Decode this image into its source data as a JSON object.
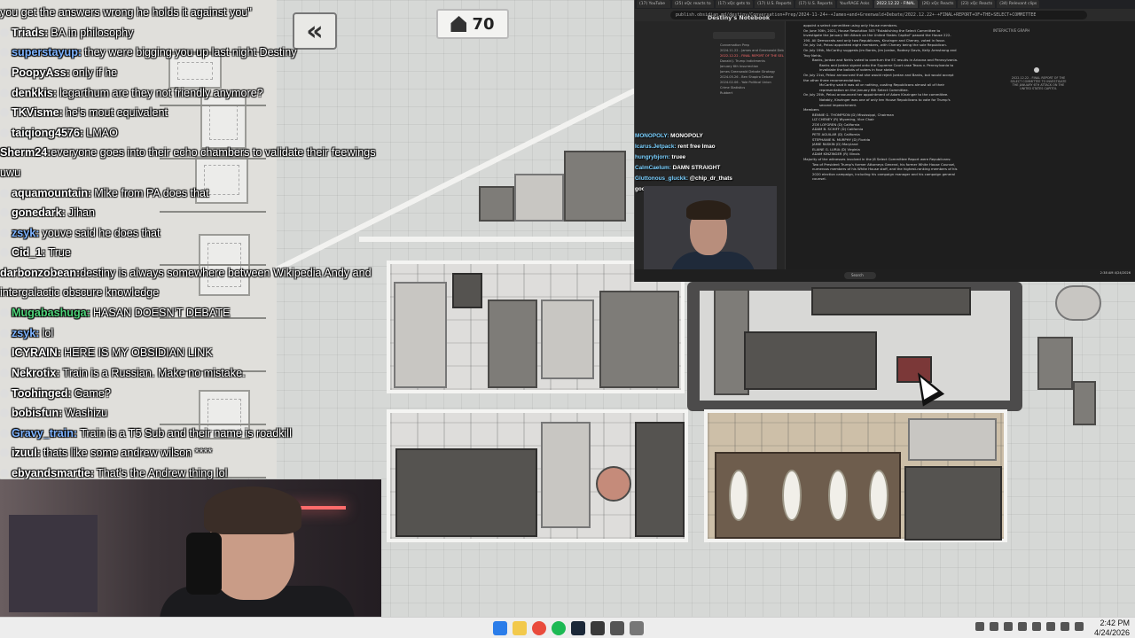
{
  "game": {
    "counter_value": "70",
    "back_label": "«"
  },
  "chat": {
    "messages": [
      {
        "user": "",
        "text": "you get the answers wrong he holds it against you\"",
        "color": "#ffffff"
      },
      {
        "user": "Triads",
        "text": "BA in philosophy",
        "color": "#ffffff"
      },
      {
        "user": "superstayup",
        "text": "they were bigging you up last night Destiny",
        "color": "#7fb4ff"
      },
      {
        "user": "PoopyAss",
        "text": "only if he",
        "color": "#ffffff"
      },
      {
        "user": "denkkis",
        "text": "legarthum are they not friendly anymore?",
        "color": "#ffffff"
      },
      {
        "user": "TKVisme",
        "text": "he's mout equivalent",
        "color": "#ffffff"
      },
      {
        "user": "taiqiong4576",
        "text": "LMAO",
        "color": "#ffffff"
      },
      {
        "user": "Sherm24",
        "text": "everyone goes into their echo chambers to validate their feewings uwu",
        "color": "#ffffff"
      },
      {
        "user": "aquamountain",
        "text": "Mike from PA does that",
        "color": "#ffffff"
      },
      {
        "user": "gonedark",
        "text": "Jihan",
        "color": "#ffffff"
      },
      {
        "user": "zsyk",
        "text": "youve said he does that",
        "color": "#7fb4ff"
      },
      {
        "user": "Cid_1",
        "text": "True",
        "color": "#ffffff"
      },
      {
        "user": "darbonzobean",
        "text": "destiny is always somewhere between Wikipedia Andy and intergalactic obscure knowledge",
        "color": "#ffffff"
      },
      {
        "user": "Mugabashuga",
        "text": "HASAN DOESN'T DEBATE",
        "color": "#4fd37a"
      },
      {
        "user": "zsyk",
        "text": "lol",
        "color": "#7fb4ff"
      },
      {
        "user": "ICYRAIN",
        "text": "HERE IS MY OBSIDIAN LINK",
        "color": "#ffffff"
      },
      {
        "user": "Nekrotix",
        "text": "Train is a Russian. Make no mistake.",
        "color": "#ffffff"
      },
      {
        "user": "Toohinged",
        "text": "Game?",
        "color": "#ffffff"
      },
      {
        "user": "bobisfun",
        "text": "Washizu",
        "color": "#ffffff"
      },
      {
        "user": "Gravy_train",
        "text": "Train is a T5 Sub and their name is roadkill",
        "color": "#7fb4ff"
      },
      {
        "user": "izuul",
        "text": "thats like some andrew wilson ****",
        "color": "#ffffff"
      },
      {
        "user": "ebyandsmartie",
        "text": "That's the Andrew thing lol",
        "color": "#ffffff"
      }
    ]
  },
  "browser": {
    "tabs": [
      "(17) YouTube",
      "(25) xQc reacts to",
      "(17) xQc gets to",
      "(17) U.S. Reports",
      "(17) U.S. Reports",
      "YourRAGE Asks",
      "2022.12.22 - FINAL",
      "(26) xQc Reacts",
      "(23) xQc Reacts",
      "(34) Relevant clips"
    ],
    "url": "publish.obsidian.md/destiny/Conversation+Prep/2024-11-24+-+James+and+Greenwald+Debate/2022.12.22+-+FINAL+REPORT+OF+THE+SELECT+COMMITTEE",
    "notebook_title": "Destiny's Notebook",
    "nav_items": [
      "Conversation Prep",
      "2024.11.22 - James and Greenwald Debate",
      "2022.12.22 - FINAL REPORT OF THE SELECT COMMITTEE TO INVESTIGATE THE JANUARY 6TH ATTACK ON THE UNITED STATES CAPITOL",
      "Donald J. Trump Indictments",
      "January 6th Insurrection",
      "James Greenwald Debate Strategy",
      "2024.05.26 - Ben Shapiro Debate",
      "2024.02.06 - Yale Political Union",
      "Crime Statistics",
      "Rubbert"
    ],
    "doc_lines": [
      "appoint a select committee using only House members.",
      "On June 30th, 2021, House Resolution 503 \"Establishing the Select Committee to",
      "Investigate the January 6th Attack on the United States Capitol\" passed the House 222-",
      "190. All Democrats and only two Republicans, Kinzinger and Cheney, voted in favor.",
      "On July 1st, Pelosi appointed eight members, with Cheney being the sole Republican.",
      "On July 19th, McCarthy suggests Jim Banks, Jim Jordan, Rodney Davis, Kelly Armstrong and",
      "Troy Nehls.",
      "Banks, Jordan and Nehls voted to overturn the EC results in Arizona and Pennsylvania.",
      "Banks and Jordan signed onto the Supreme Court case Texas v. Pennsylvania to",
      "invalidate the ballots of voters in four states.",
      "On July 21st, Pelosi announced that she would reject Jordan and Banks, but would accept",
      "the other three recommendations.",
      "McCarthy said it was all or nothing, ousting Republicans almost all of their",
      "representation on the January 6th Select Committee.",
      "On July 25th, Pelosi announced her appointment of Adam Kinzinger to the committee.",
      "Notably, Kinzinger was one of only ten House Republicans to vote for Trump's",
      "second impeachment.",
      "Members",
      "BENNIE G. THOMPSON (D) Mississippi, Chairman",
      "LIZ CHENEY (R) Wyoming, Vice Chair",
      "ZOE LOFGREN (D) California",
      "ADAM B. SCHIFF (D) California",
      "PETE AGUILAR (D) California",
      "STEPHANIE N. MURPHY (D) Florida",
      "JAMIE RASKIN (D) Maryland",
      "ELAINE G. LURIA (D) Virginia",
      "ADAM KINZINGER (R) Illinois",
      "Majority of the witnesses involved in the J6 Select Committee Report were Republicans:",
      "Two of President Trump's former Attorneys General, his former White House Counsel,",
      "numerous members of his White House staff, and the highest-ranking members of his",
      "2020 election campaign, including his campaign manager and his campaign general",
      "counsel."
    ],
    "graph_title": "INTERACTIVE GRAPH",
    "graph_label": "2022.12.22 - FINAL REPORT OF THE SELECT COMMITTEE TO INVESTIGATE THE JANUARY 6TH ATTACK ON THE UNITED STATES CAPITOL",
    "chat_lines": [
      {
        "user": "MONOPOLY",
        "text": "MONOPOLY"
      },
      {
        "user": "Icarus.Jetpack",
        "text": "rent free lmao"
      },
      {
        "user": "hungrybjorn",
        "text": "truee"
      },
      {
        "user": "CalmCaelum",
        "text": "DAMN STRAIGHT"
      },
      {
        "user": "Gluttonous_gluckk",
        "text": "@chip_dr_thats"
      },
      {
        "user": "",
        "text": "good"
      }
    ],
    "search_label": "Search",
    "mini_clock": "2:38 AM\n4/24/2026"
  },
  "taskbar": {
    "time": "2:42 PM",
    "date": "4/24/2026"
  }
}
